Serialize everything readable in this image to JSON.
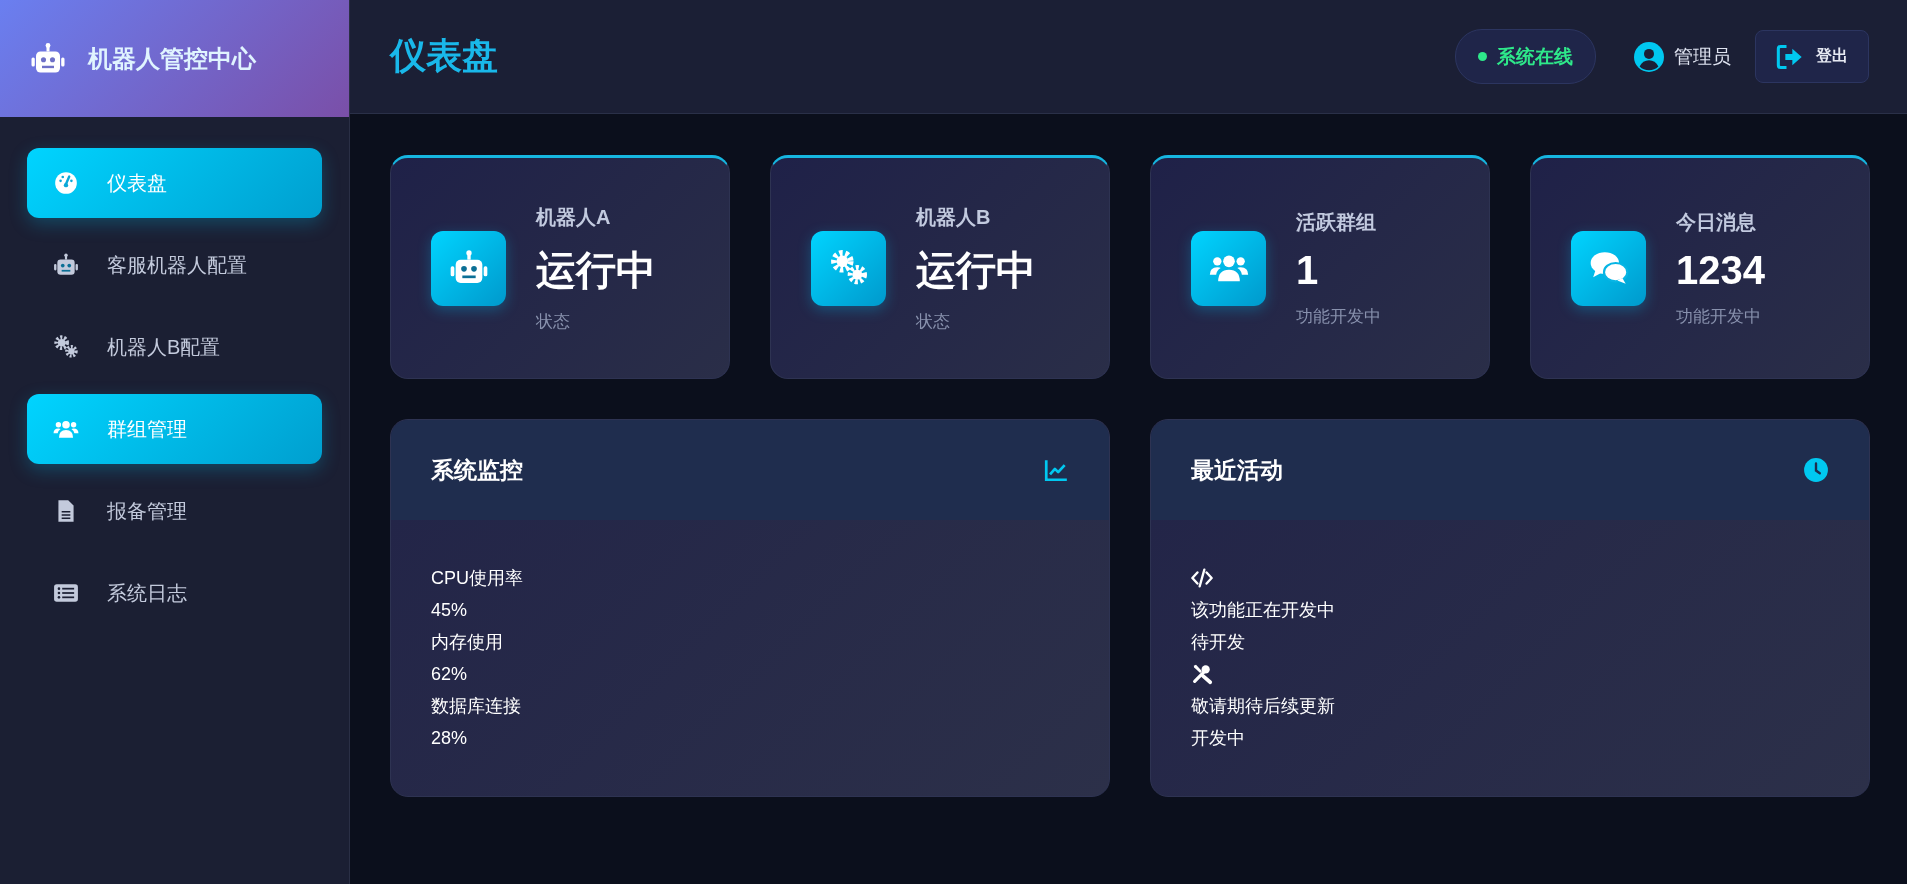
{
  "brand": {
    "title": "机器人管控中心"
  },
  "sidebar": {
    "items": [
      {
        "label": "仪表盘",
        "kind": "gauge",
        "selected": true
      },
      {
        "label": "客服机器人配置",
        "kind": "robot",
        "selected": false
      },
      {
        "label": "机器人B配置",
        "kind": "gears",
        "selected": false
      },
      {
        "label": "群组管理",
        "kind": "users",
        "selected": true
      },
      {
        "label": "报备管理",
        "kind": "file",
        "selected": false
      },
      {
        "label": "系统日志",
        "kind": "list",
        "selected": false
      }
    ]
  },
  "header": {
    "title": "仪表盘",
    "status": "系统在线",
    "user": "管理员",
    "logout": "登出"
  },
  "stats": [
    {
      "title": "机器人A",
      "value": "运行中",
      "note": "状态",
      "kind": "robot"
    },
    {
      "title": "机器人B",
      "value": "运行中",
      "note": "状态",
      "kind": "gears"
    },
    {
      "title": "活跃群组",
      "value": "1",
      "note": "功能开发中",
      "kind": "users"
    },
    {
      "title": "今日消息",
      "value": "1234",
      "note": "功能开发中",
      "kind": "comments"
    }
  ],
  "monitor": {
    "title": "系统监控",
    "metrics": [
      {
        "label": "CPU使用率",
        "value": "45%"
      },
      {
        "label": "内存使用",
        "value": "62%"
      },
      {
        "label": "数据库连接",
        "value": "28%"
      }
    ]
  },
  "activity": {
    "title": "最近活动",
    "items": [
      {
        "kind": "code"
      },
      {
        "kind": "text",
        "text": "该功能正在开发中"
      },
      {
        "kind": "text",
        "text": "待开发"
      },
      {
        "kind": "tools"
      },
      {
        "kind": "text",
        "text": "敬请期待后续更新"
      },
      {
        "kind": "text",
        "text": "开发中"
      }
    ]
  }
}
